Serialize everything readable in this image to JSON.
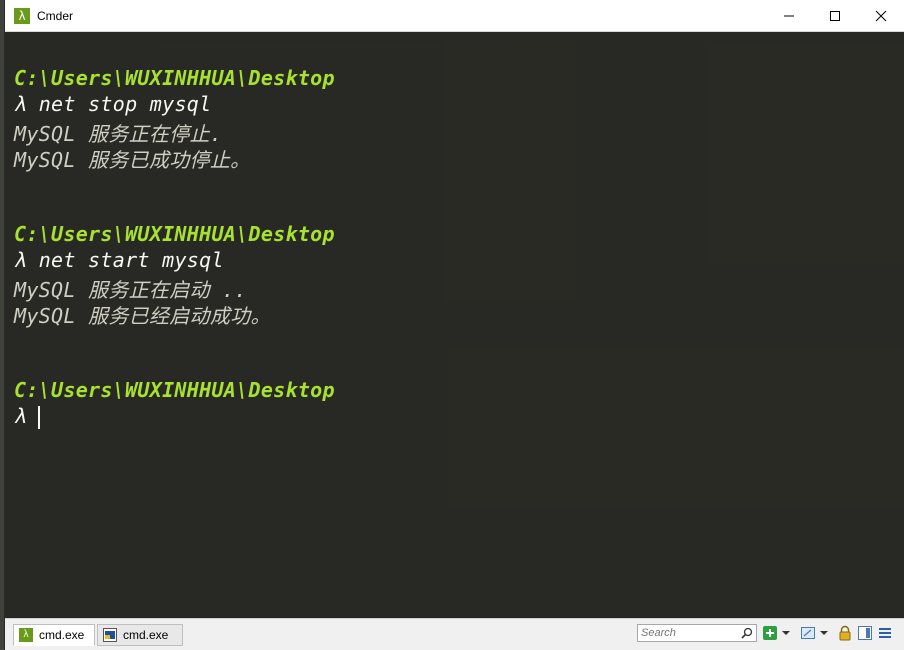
{
  "window": {
    "title": "Cmder",
    "app_icon": "λ"
  },
  "terminal": {
    "prompt_symbol": "λ",
    "blocks": [
      {
        "path": "C:\\Users\\WUXINHHUA\\Desktop",
        "command": "net stop mysql",
        "output": [
          "MySQL 服务正在停止.",
          "MySQL 服务已成功停止。"
        ]
      },
      {
        "path": "C:\\Users\\WUXINHHUA\\Desktop",
        "command": "net start mysql",
        "output": [
          "MySQL 服务正在启动 ..",
          "MySQL 服务已经启动成功。"
        ]
      },
      {
        "path": "C:\\Users\\WUXINHHUA\\Desktop",
        "command": "",
        "output": []
      }
    ]
  },
  "statusbar": {
    "tabs": [
      {
        "label": "cmd.exe",
        "icon": "λ",
        "active": true
      },
      {
        "label": "cmd.exe",
        "icon": "cmd-icon",
        "active": false
      }
    ],
    "search_placeholder": "Search"
  },
  "colors": {
    "path": "#a6e22e",
    "command": "#f8f8f2",
    "output": "#cfcfc2",
    "background": "#272822"
  }
}
